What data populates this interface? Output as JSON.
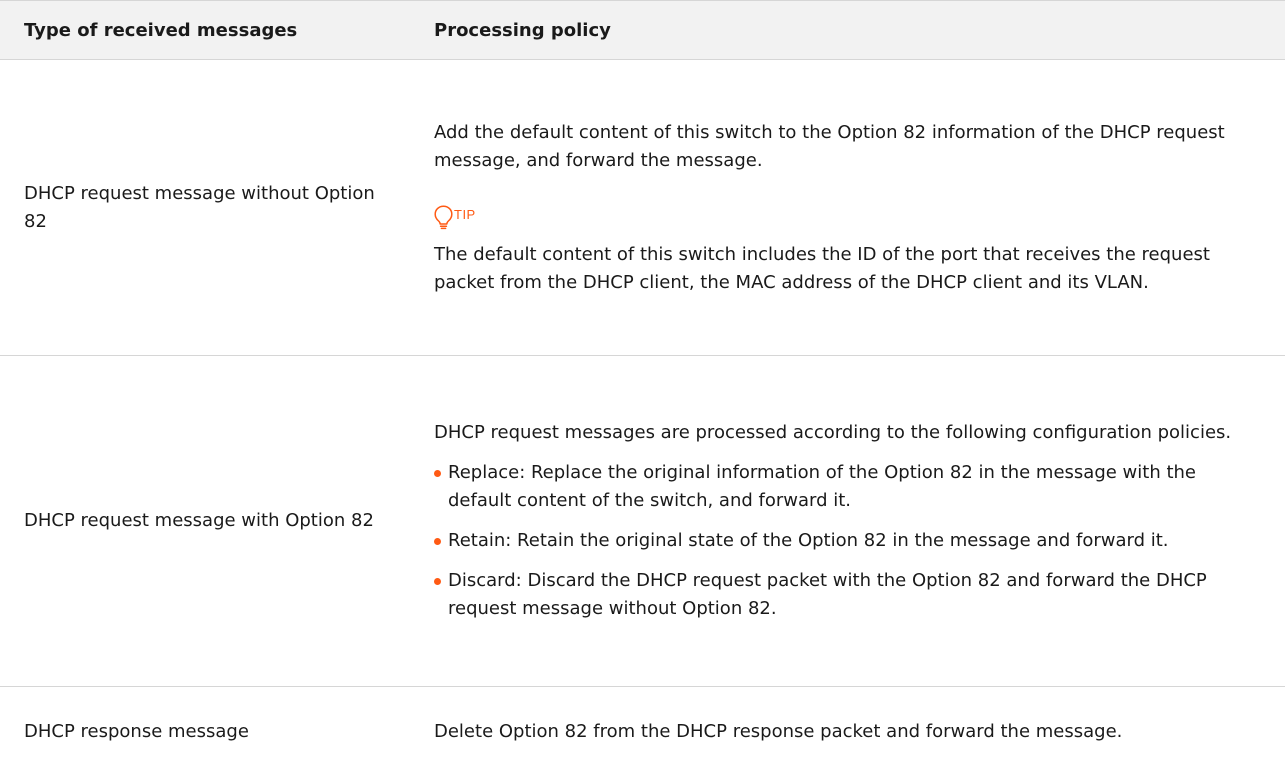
{
  "table": {
    "header": {
      "type_col": "Type of received messages",
      "policy_col": "Processing policy"
    },
    "rows": [
      {
        "type": "DHCP request message without Option 82",
        "policy_text": "Add the default content of this switch to the Option 82 information of the DHCP request message, and forward the message.",
        "tip_label": "TIP",
        "tip_text": "The default content of this switch includes the ID of the port that receives the request packet from the DHCP client, the MAC address of the DHCP client and its VLAN."
      },
      {
        "type": "DHCP request message with Option 82",
        "policy_text": "DHCP request messages are processed according to the following configuration policies.",
        "items": [
          "Replace: Replace the original information of the Option 82 in the message with the default content of the switch, and forward it.",
          "Retain: Retain the original state of the Option 82 in the message and forward it.",
          "Discard: Discard the DHCP request packet with the Option 82 and forward the DHCP request message without Option 82."
        ]
      },
      {
        "type": "DHCP response message",
        "policy_text": "Delete Option 82 from the DHCP response packet and forward the message."
      }
    ]
  },
  "colors": {
    "accent": "#ff5a14",
    "header_bg": "#f2f2f2",
    "rule": "#d6d6d6"
  },
  "icons": {
    "tip": "lightbulb-icon",
    "bullet": "bullet-dot"
  }
}
